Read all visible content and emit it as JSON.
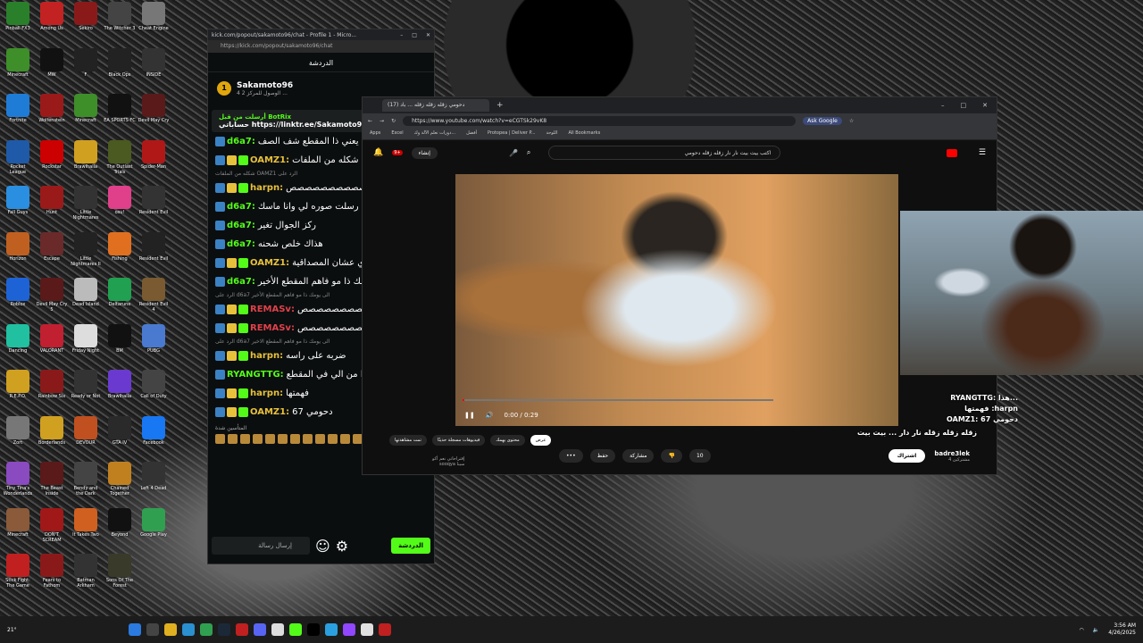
{
  "desktop": {
    "icons": [
      {
        "label": "Pinball FX3",
        "color": "#2a7f2a"
      },
      {
        "label": "Among Us",
        "color": "#c32222"
      },
      {
        "label": "Sekiro",
        "color": "#8a1a1a"
      },
      {
        "label": "The Witcher 3",
        "color": "#444"
      },
      {
        "label": "Cheat Engine",
        "color": "#777"
      },
      {
        "label": "Minecraft",
        "color": "#3e8e2a"
      },
      {
        "label": "MW",
        "color": "#111"
      },
      {
        "label": "F",
        "color": "#222"
      },
      {
        "label": "Black Ops",
        "color": "#222"
      },
      {
        "label": "INSIDE",
        "color": "#333"
      },
      {
        "label": "Fortnite",
        "color": "#1f7cd6"
      },
      {
        "label": "Wolfenstein",
        "color": "#9a1a1a"
      },
      {
        "label": "Minecraft",
        "color": "#3e8e2a"
      },
      {
        "label": "EA SPORTS FC",
        "color": "#111"
      },
      {
        "label": "Devil May Cry",
        "color": "#5a1a1a"
      },
      {
        "label": "Rocket League",
        "color": "#1e5aa8"
      },
      {
        "label": "Rockstar",
        "color": "#c00"
      },
      {
        "label": "Brawlhalla",
        "color": "#d0a020"
      },
      {
        "label": "The Outlast Trials",
        "color": "#4a5a20"
      },
      {
        "label": "Spider-Man",
        "color": "#b01818"
      },
      {
        "label": "Fall Guys",
        "color": "#2a8fe0"
      },
      {
        "label": "Hunt",
        "color": "#9a1a1a"
      },
      {
        "label": "Little Nightmares",
        "color": "#333"
      },
      {
        "label": "osu!",
        "color": "#e0408a"
      },
      {
        "label": "Resident Evil",
        "color": "#333"
      },
      {
        "label": "Horizon",
        "color": "#c06020"
      },
      {
        "label": "Escape",
        "color": "#6a2a2a"
      },
      {
        "label": "Little Nightmares II",
        "color": "#222"
      },
      {
        "label": "Fishing",
        "color": "#e07020"
      },
      {
        "label": "Resident Evil",
        "color": "#222"
      },
      {
        "label": "Roblox",
        "color": "#1e63d6"
      },
      {
        "label": "Devil May Cry 5",
        "color": "#5a1a1a"
      },
      {
        "label": "Dead Island",
        "color": "#bbb"
      },
      {
        "label": "Deltarune",
        "color": "#20a050"
      },
      {
        "label": "Resident Evil 4",
        "color": "#7a5a30"
      },
      {
        "label": "Dancing",
        "color": "#20c0a0"
      },
      {
        "label": "VALORANT",
        "color": "#c02030"
      },
      {
        "label": "Friday Night",
        "color": "#ddd"
      },
      {
        "label": "BM",
        "color": "#111"
      },
      {
        "label": "PUBG",
        "color": "#4a7ad0"
      },
      {
        "label": "R.E.P.O.",
        "color": "#d0a020"
      },
      {
        "label": "Rainbow Six",
        "color": "#8a1a1a"
      },
      {
        "label": "Ready or Not",
        "color": "#333"
      },
      {
        "label": "Brawlhalla",
        "color": "#6a3ad0"
      },
      {
        "label": "Call of Duty",
        "color": "#444"
      },
      {
        "label": "Zort",
        "color": "#777"
      },
      {
        "label": "Borderlands",
        "color": "#d0a020"
      },
      {
        "label": "DEVOUR",
        "color": "#c05020"
      },
      {
        "label": "GTA IV",
        "color": "#2a2a2a"
      },
      {
        "label": "Facebook",
        "color": "#1877f2"
      },
      {
        "label": "Tiny Tina's Wonderlands",
        "color": "#8a4ac0"
      },
      {
        "label": "The Beast Inside",
        "color": "#5a1a1a"
      },
      {
        "label": "Bendy and the Dark Revival",
        "color": "#444"
      },
      {
        "label": "Chained Together",
        "color": "#c08020"
      },
      {
        "label": "Left 4 Dead",
        "color": "#333"
      },
      {
        "label": "Minecraft",
        "color": "#8a5a3a"
      },
      {
        "label": "DON'T SCREAM",
        "color": "#a01818"
      },
      {
        "label": "It Takes Two",
        "color": "#d06020"
      },
      {
        "label": "Beyond",
        "color": "#111"
      },
      {
        "label": "Google Play",
        "color": "#30a050"
      },
      {
        "label": "Stick Fight: The Game",
        "color": "#c02020"
      },
      {
        "label": "Fears to Fathom",
        "color": "#8a1a1a"
      },
      {
        "label": "Batman Arkham",
        "color": "#333"
      },
      {
        "label": "Sons Of The Forest",
        "color": "#3a3a2a"
      }
    ]
  },
  "kick": {
    "window_title": "kick.com/popout/sakamoto96/chat - Profile 1 - Micro...",
    "url": "https://kick.com/popout/sakamoto96/chat",
    "header": "الدردشة",
    "streamer_name": "Sakamoto96",
    "streamer_rank": "1",
    "streamer_sub": "4",
    "streamer_note": "الوصول للمركز 2 ...",
    "bot_line1": "أرسلت من قبل BotRix",
    "bot_line2": "حساباتي https://linktr.ee/Sakamoto96",
    "messages": [
      {
        "user": "d6a7:",
        "text": "يعني ذا المقطع شف الصف",
        "color": "#53fc18",
        "badges": false
      },
      {
        "user": "OAMZ1:",
        "text": "شكله من الملفات",
        "color": "#e7c13b",
        "badges": true
      },
      {
        "reply": "شكله من الملفات OAMZ1 الرد على"
      },
      {
        "user": "harpn:",
        "text": "صصصصصصصصصصص",
        "color": "#e7c13b",
        "badges": true
      },
      {
        "user": "d6a7:",
        "text": "رسلت صوره لي وانا ماسك ban",
        "color": "#53fc18",
        "badges": false
      },
      {
        "user": "d6a7:",
        "text": "ركز الجوال تغير",
        "color": "#53fc18",
        "badges": false
      },
      {
        "user": "d6a7:",
        "text": "هذاك خلص شحنه",
        "color": "#53fc18",
        "badges": false
      },
      {
        "user": "OAMZ1:",
        "text": "كل مره نشوفه وهو يشرب الماي عشان المصداقية",
        "color": "#e7c13b",
        "badges": true
      },
      {
        "user": "d6a7:",
        "text": "الى يومك ذا مو فاهم المقطع الأخير",
        "color": "#53fc18",
        "badges": false
      },
      {
        "reply": "الرد على d6a7 الى يومك ذا مو فاهم المقطع الأخير"
      },
      {
        "user": "REMASv:",
        "text": "صصصصصصصصص",
        "color": "#e0414a",
        "badges": true
      },
      {
        "user": "REMASv:",
        "text": "صصصصصصصصص",
        "color": "#e0414a",
        "badges": true
      },
      {
        "reply": "الرد على d6a7 الى يومك ذا مو فاهم المقطع الاخير"
      },
      {
        "user": "harpn:",
        "text": "ضربه على راسه",
        "color": "#e7c13b",
        "badges": true
      },
      {
        "user": "RYANGTTG:",
        "text": "هذا من الي في المقطع",
        "color": "#53fc18",
        "badges": false
      },
      {
        "user": "harpn:",
        "text": "فهمتها",
        "color": "#e7c13b",
        "badges": true
      },
      {
        "user": "OAMZ1:",
        "text": "67 دحومي",
        "color": "#e7c13b",
        "badges": true
      }
    ],
    "emotes_label": "المتأسين شدة",
    "input_placeholder": "إرسال رسالة",
    "send_label": "الدردشة"
  },
  "browser": {
    "tab_title": "(17) دحومي زقله زقله زقله ... باد",
    "url": "https://www.youtube.com/watch?v=eCGTSk29vK8",
    "ask_google": "Ask Google",
    "bookmarks": [
      "Apps",
      "Excel",
      "دورات تعلم الآلة وك...",
      "أفضل",
      "Protopea | Deliver P...",
      "اللوحة",
      "All Bookmarks"
    ],
    "yt_search_value": "اكتب بيت بيت نار نار زقله زقله دحومي",
    "create_label": "إنشاء",
    "notif_count": "9+",
    "time": "0:00 / 0:29",
    "progress": 0.006,
    "video_title": "زقله زقله زقله نار دار ... بيت بيت",
    "chips": [
      "عرض",
      "محتوى يهمك",
      "فيديوهات مسجلة حديثًا",
      "تمت مشاهدتها"
    ],
    "like_count": "10",
    "share_label": "مشاركة",
    "save_label": "حفظ",
    "channel_name": "badre3lek",
    "channel_subs": "4 مشتركين",
    "subscribe_label": "اشتراك",
    "playlist_title": "إقتراحاتي نعم أكو",
    "playlist_by": "sooqya سينا"
  },
  "stream_overlay": {
    "lines": [
      "RYANGTTG: هذا...",
      "فهمتها :harpn",
      "OAMZ1: دحومي 67",
      "...دحومي زقله زقله نار دار ... بيت بيت"
    ]
  },
  "taskbar": {
    "weather": "21°",
    "time": "3:56 AM",
    "date": "4/26/2025"
  }
}
